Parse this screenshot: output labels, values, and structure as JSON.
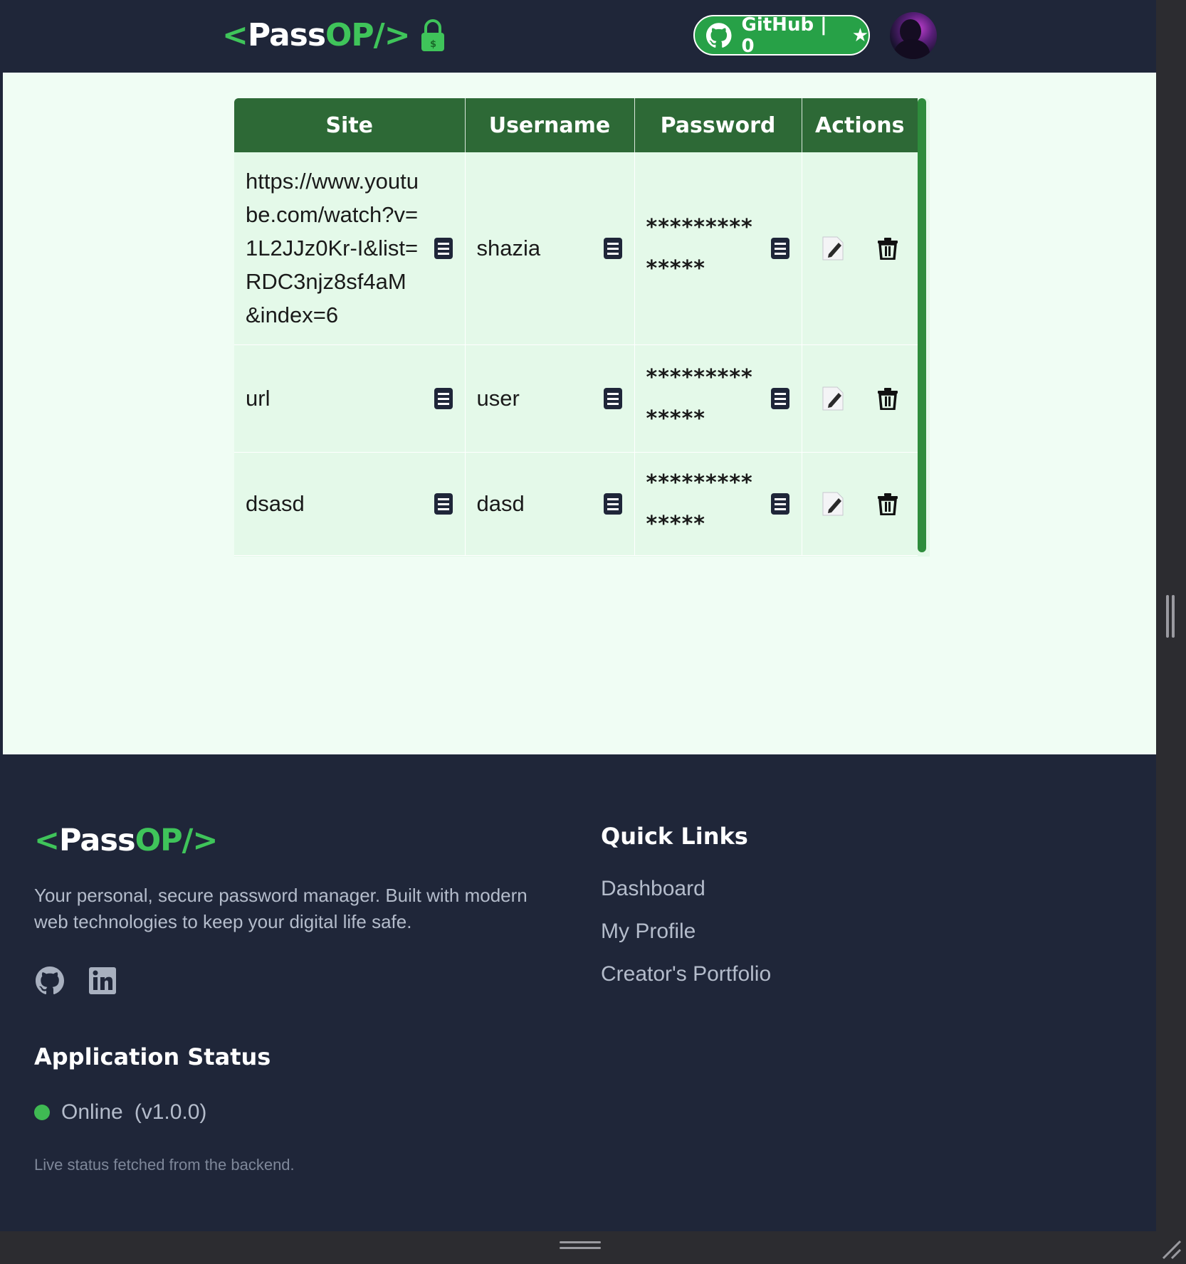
{
  "header": {
    "logo": {
      "lt": "<",
      "pass": "Pass",
      "op": "OP/",
      "gt": " >"
    },
    "github_button": {
      "label": "GitHub | 0",
      "star": "★"
    }
  },
  "table": {
    "columns": [
      "Site",
      "Username",
      "Password",
      "Actions"
    ],
    "rows": [
      {
        "site": "https://www.youtube.com/watch?v=1L2JJz0Kr-I&list=RDC3njz8sf4aM&index=6",
        "username": "shazia",
        "password": "**************"
      },
      {
        "site": "url",
        "username": "user",
        "password": "**************"
      },
      {
        "site": "dsasd",
        "username": "dasd",
        "password": "**************"
      }
    ]
  },
  "footer": {
    "logo": {
      "lt": "<",
      "pass": "Pass",
      "op": "OP/",
      "gt": ">"
    },
    "description": "Your personal, secure password manager. Built with modern web technologies to keep your digital life safe.",
    "status_title": "Application Status",
    "status_text": "Online",
    "version": "(v1.0.0)",
    "status_note": "Live status fetched from the backend.",
    "quick_links_title": "Quick Links",
    "quick_links": [
      "Dashboard",
      "My Profile",
      "Creator's Portfolio"
    ]
  },
  "icons": {
    "copy": "copy-icon",
    "edit": "edit-icon",
    "delete": "trash-icon",
    "github": "github-icon",
    "linkedin": "linkedin-icon",
    "lock": "lock-icon"
  },
  "colors": {
    "brand_green": "#3fc45a",
    "header_green": "#2d6936",
    "dark_bg": "#1f2639",
    "main_bg": "#f0fdf4",
    "row_bg": "#e4f9e9",
    "status_online": "#3fba53"
  }
}
